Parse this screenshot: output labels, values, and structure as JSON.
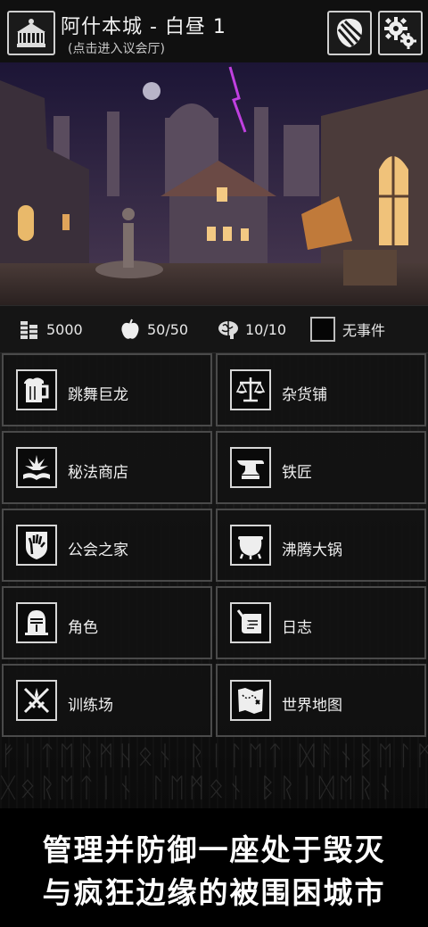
{
  "header": {
    "title": "阿什本城 - 白昼 1",
    "subtitle": "(点击进入议会厅)",
    "hall_icon": "town-hall-icon",
    "shield_icon": "shield-icon",
    "settings_icon": "gear-icon"
  },
  "resources": {
    "coins": {
      "icon": "coins-icon",
      "value": "5000"
    },
    "food": {
      "icon": "apple-icon",
      "value": "50/50"
    },
    "sanity": {
      "icon": "brain-icon",
      "value": "10/10"
    },
    "event": {
      "icon": "event-box-icon",
      "label": "无事件"
    }
  },
  "buildings": [
    {
      "label": "跳舞巨龙",
      "icon": "tankard-icon"
    },
    {
      "label": "杂货铺",
      "icon": "scales-icon"
    },
    {
      "label": "秘法商店",
      "icon": "spellbook-icon"
    },
    {
      "label": "铁匠",
      "icon": "anvil-icon"
    },
    {
      "label": "公会之家",
      "icon": "guild-hand-icon"
    },
    {
      "label": "沸腾大锅",
      "icon": "cauldron-icon"
    },
    {
      "label": "角色",
      "icon": "helmet-icon"
    },
    {
      "label": "日志",
      "icon": "quill-scroll-icon"
    },
    {
      "label": "训练场",
      "icon": "crossed-swords-icon"
    },
    {
      "label": "世界地图",
      "icon": "map-icon"
    }
  ],
  "banner": {
    "line1": "管理并防御一座处于毁灭",
    "line2": "与疯狂边缘的被围困城市"
  },
  "colors": {
    "background": "#0c0c0c",
    "tile_border": "#4a4a4a",
    "text": "#efefef"
  }
}
